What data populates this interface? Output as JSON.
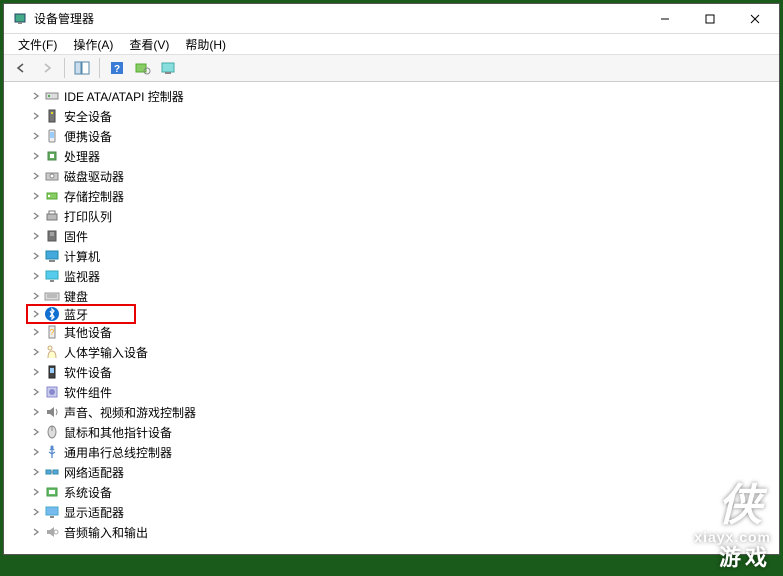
{
  "window": {
    "title": "设备管理器"
  },
  "menu": {
    "file": "文件(F)",
    "action": "操作(A)",
    "view": "查看(V)",
    "help": "帮助(H)"
  },
  "toolbar": {
    "back": "back-icon",
    "forward": "forward-icon",
    "details": "details-icon",
    "help": "help-icon",
    "scan": "scan-icon",
    "monitor": "monitor-icon"
  },
  "tree": [
    {
      "icon": "ide-icon",
      "label": "IDE ATA/ATAPI 控制器",
      "expandable": true
    },
    {
      "icon": "security-icon",
      "label": "安全设备",
      "expandable": true
    },
    {
      "icon": "portable-icon",
      "label": "便携设备",
      "expandable": true
    },
    {
      "icon": "cpu-icon",
      "label": "处理器",
      "expandable": true
    },
    {
      "icon": "disk-icon",
      "label": "磁盘驱动器",
      "expandable": true
    },
    {
      "icon": "storage-icon",
      "label": "存储控制器",
      "expandable": true
    },
    {
      "icon": "printer-icon",
      "label": "打印队列",
      "expandable": true
    },
    {
      "icon": "firmware-icon",
      "label": "固件",
      "expandable": true
    },
    {
      "icon": "computer-icon",
      "label": "计算机",
      "expandable": true
    },
    {
      "icon": "monitor-icon",
      "label": "监视器",
      "expandable": true
    },
    {
      "icon": "keyboard-icon",
      "label": "键盘",
      "expandable": true
    },
    {
      "icon": "bluetooth-icon",
      "label": "蓝牙",
      "expandable": true,
      "highlighted": true
    },
    {
      "icon": "other-icon",
      "label": "其他设备",
      "expandable": true
    },
    {
      "icon": "hid-icon",
      "label": "人体学输入设备",
      "expandable": true
    },
    {
      "icon": "softdev-icon",
      "label": "软件设备",
      "expandable": true
    },
    {
      "icon": "softcomp-icon",
      "label": "软件组件",
      "expandable": true
    },
    {
      "icon": "audio-icon",
      "label": "声音、视频和游戏控制器",
      "expandable": true
    },
    {
      "icon": "mouse-icon",
      "label": "鼠标和其他指针设备",
      "expandable": true
    },
    {
      "icon": "usb-icon",
      "label": "通用串行总线控制器",
      "expandable": true
    },
    {
      "icon": "network-icon",
      "label": "网络适配器",
      "expandable": true
    },
    {
      "icon": "system-icon",
      "label": "系统设备",
      "expandable": true
    },
    {
      "icon": "display-icon",
      "label": "显示适配器",
      "expandable": true
    },
    {
      "icon": "soundio-icon",
      "label": "音频输入和输出",
      "expandable": true
    }
  ],
  "watermark": {
    "logo": "侠",
    "url": "xiayx.com",
    "cn": "游戏"
  }
}
